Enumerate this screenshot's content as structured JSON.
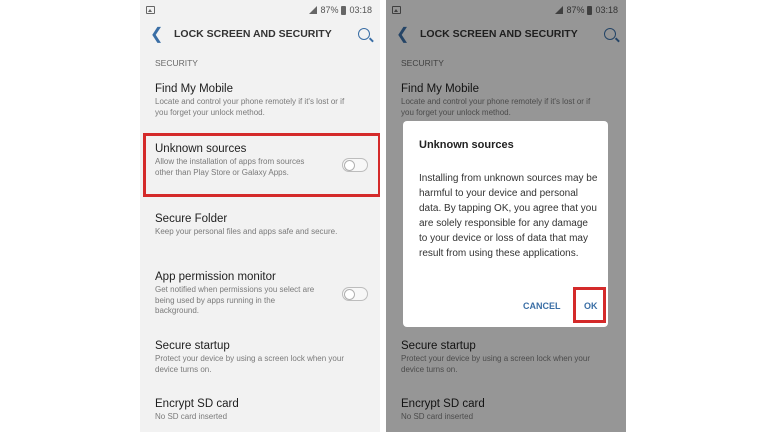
{
  "status_bar": {
    "battery": "87%",
    "time": "03:18"
  },
  "header": {
    "title": "LOCK SCREEN AND SECURITY"
  },
  "section_label": "SECURITY",
  "items": [
    {
      "title": "Find My Mobile",
      "subtitle": "Locate and control your phone remotely if it's lost or if you forget your unlock method."
    },
    {
      "title": "Unknown sources",
      "subtitle": "Allow the installation of apps from sources other than Play Store or Galaxy Apps.",
      "toggle": "off"
    },
    {
      "title": "Secure Folder",
      "subtitle": "Keep your personal files and apps safe and secure."
    },
    {
      "title": "App permission monitor",
      "subtitle": "Get notified when permissions you select are being used by apps running in the background.",
      "toggle": "off"
    },
    {
      "title": "Secure startup",
      "subtitle": "Protect your device by using a screen lock when your device turns on."
    },
    {
      "title": "Encrypt SD card",
      "subtitle": "No SD card inserted"
    }
  ],
  "dialog": {
    "title": "Unknown sources",
    "body": "Installing from unknown sources may be harmful to your device and personal data. By tapping OK, you agree that you are solely responsible for any damage to your device or loss of data that may result from using these applications.",
    "cancel_label": "CANCEL",
    "ok_label": "OK"
  },
  "colors": {
    "accent": "#3a6ea5",
    "highlight": "#d42a2a",
    "background": "#f2f2f2"
  },
  "icons": [
    "image-icon",
    "signal-icon",
    "battery-icon",
    "back-arrow-icon",
    "search-icon"
  ]
}
